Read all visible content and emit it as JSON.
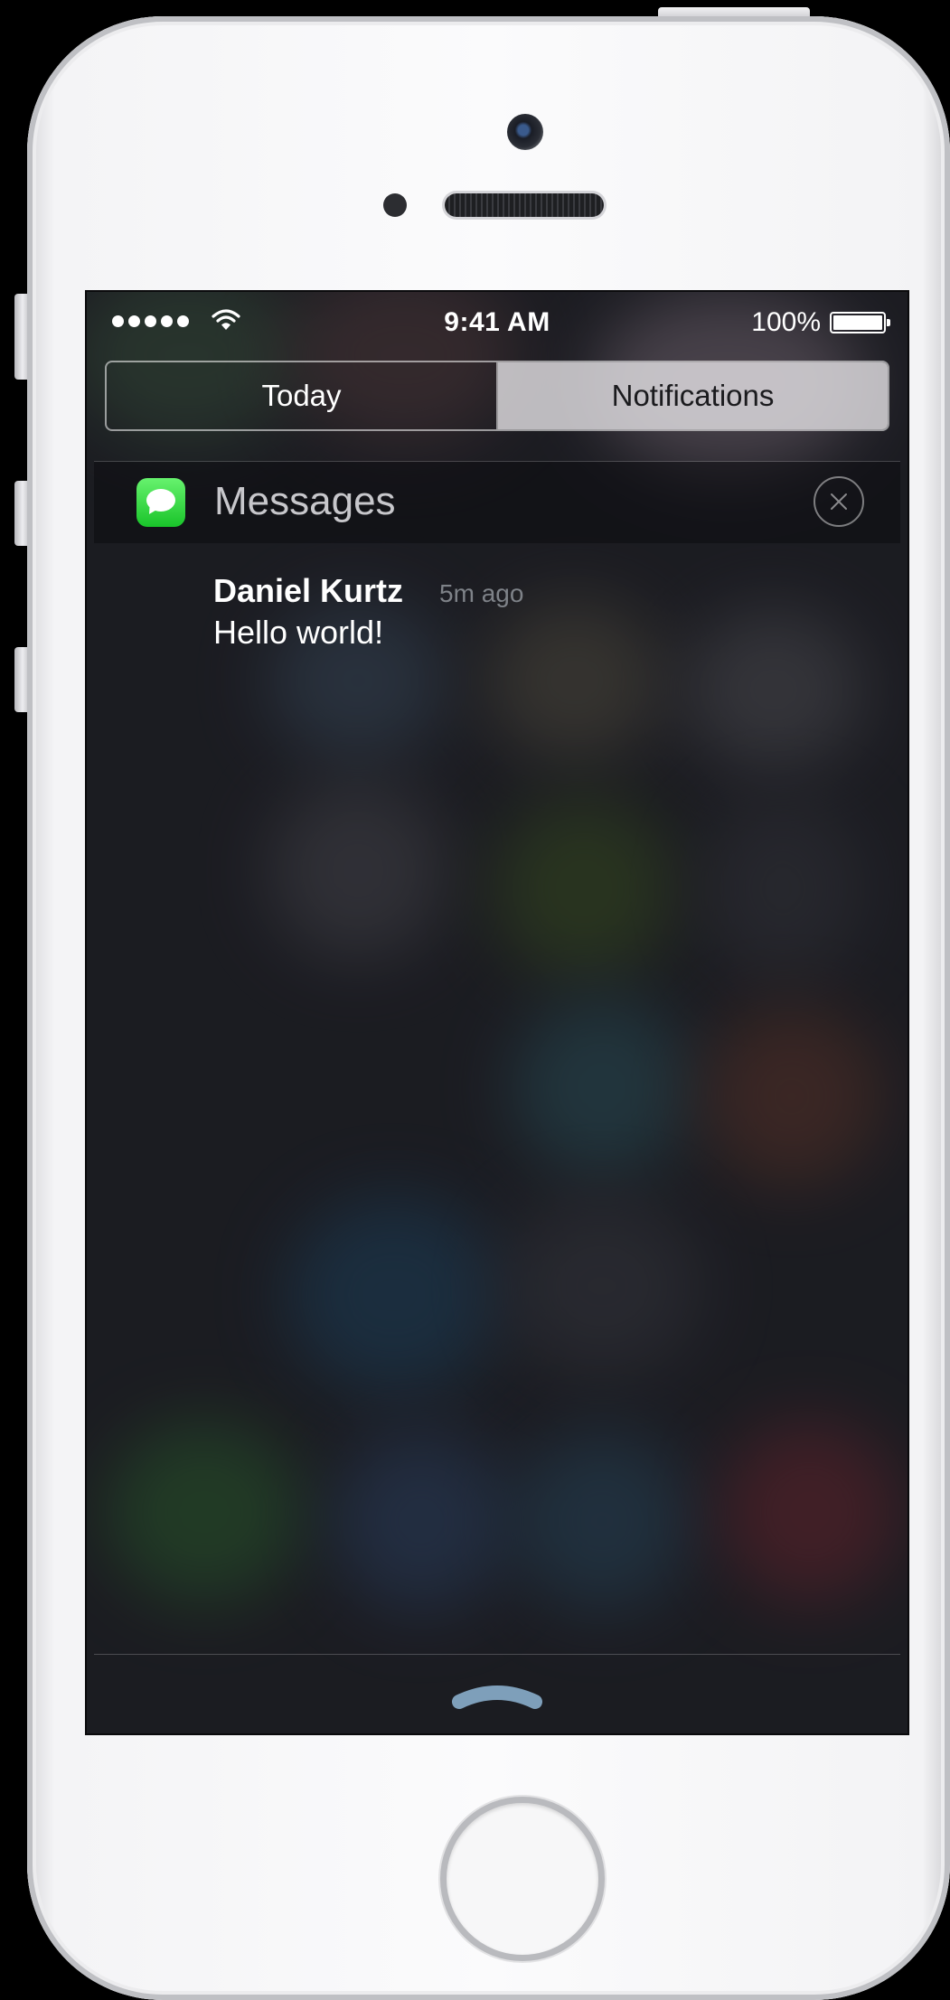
{
  "status_bar": {
    "time": "9:41 AM",
    "battery_percent": "100%",
    "signal_bars": 5,
    "wifi": "wifi-icon",
    "battery_level": 1.0
  },
  "tabs": [
    {
      "label": "Today",
      "selected": false
    },
    {
      "label": "Notifications",
      "selected": true
    }
  ],
  "section": {
    "app_name": "Messages",
    "app_icon": "messages-app-icon",
    "clear_icon": "close-circle-icon",
    "icon_color": "#1fcf35"
  },
  "notification": {
    "sender": "Daniel Kurtz",
    "time_ago": "5m ago",
    "message": "Hello world!"
  },
  "colors": {
    "segment_selected_bg": "#e1dee2",
    "screen_bg": "#1e1f24",
    "muted_text": "#7e8288"
  },
  "pull_handle_icon": "chevron-up-handle-icon"
}
